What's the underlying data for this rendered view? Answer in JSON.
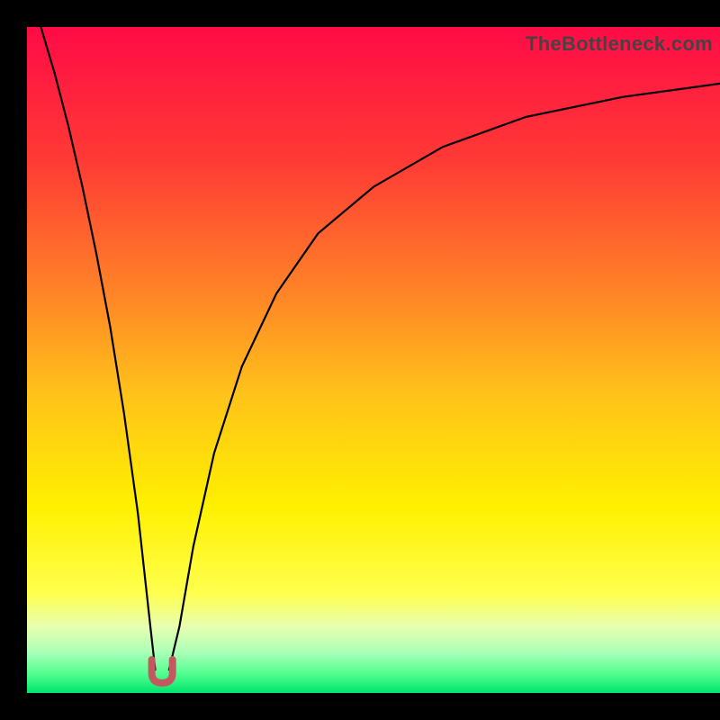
{
  "watermark": "TheBottleneck.com",
  "chart_data": {
    "type": "line",
    "title": "",
    "xlabel": "",
    "ylabel": "",
    "xlim": [
      0,
      100
    ],
    "ylim": [
      0,
      100
    ],
    "grid": false,
    "background": {
      "type": "vertical-gradient",
      "stops": [
        {
          "pos": 0.0,
          "color": "#ff0b46"
        },
        {
          "pos": 0.2,
          "color": "#ff3a35"
        },
        {
          "pos": 0.4,
          "color": "#ff8427"
        },
        {
          "pos": 0.55,
          "color": "#ffc21a"
        },
        {
          "pos": 0.72,
          "color": "#fff000"
        },
        {
          "pos": 0.85,
          "color": "#ffff4d"
        },
        {
          "pos": 0.9,
          "color": "#e8ffb0"
        },
        {
          "pos": 0.94,
          "color": "#a8ffb8"
        },
        {
          "pos": 0.97,
          "color": "#55ff90"
        },
        {
          "pos": 1.0,
          "color": "#00e56b"
        }
      ]
    },
    "series": [
      {
        "name": "left-branch",
        "stroke": "#000000",
        "x": [
          2,
          4,
          6,
          8,
          10,
          12,
          14,
          16,
          17.8,
          18.5
        ],
        "y": [
          100,
          93,
          85,
          76,
          66,
          55,
          42,
          27,
          10,
          3.5
        ]
      },
      {
        "name": "right-branch",
        "stroke": "#000000",
        "x": [
          20.5,
          22,
          24,
          27,
          31,
          36,
          42,
          50,
          60,
          72,
          86,
          100
        ],
        "y": [
          3.5,
          10,
          22,
          36,
          49,
          60,
          69,
          76,
          82,
          86.5,
          89.5,
          91.5
        ]
      }
    ],
    "annotations": [
      {
        "name": "cusp-marker",
        "type": "u-shape",
        "x_center": 19.5,
        "y_bottom": 1.5,
        "width": 3.0,
        "height": 3.5,
        "color": "#c3595f",
        "stroke_width": 8
      }
    ]
  }
}
